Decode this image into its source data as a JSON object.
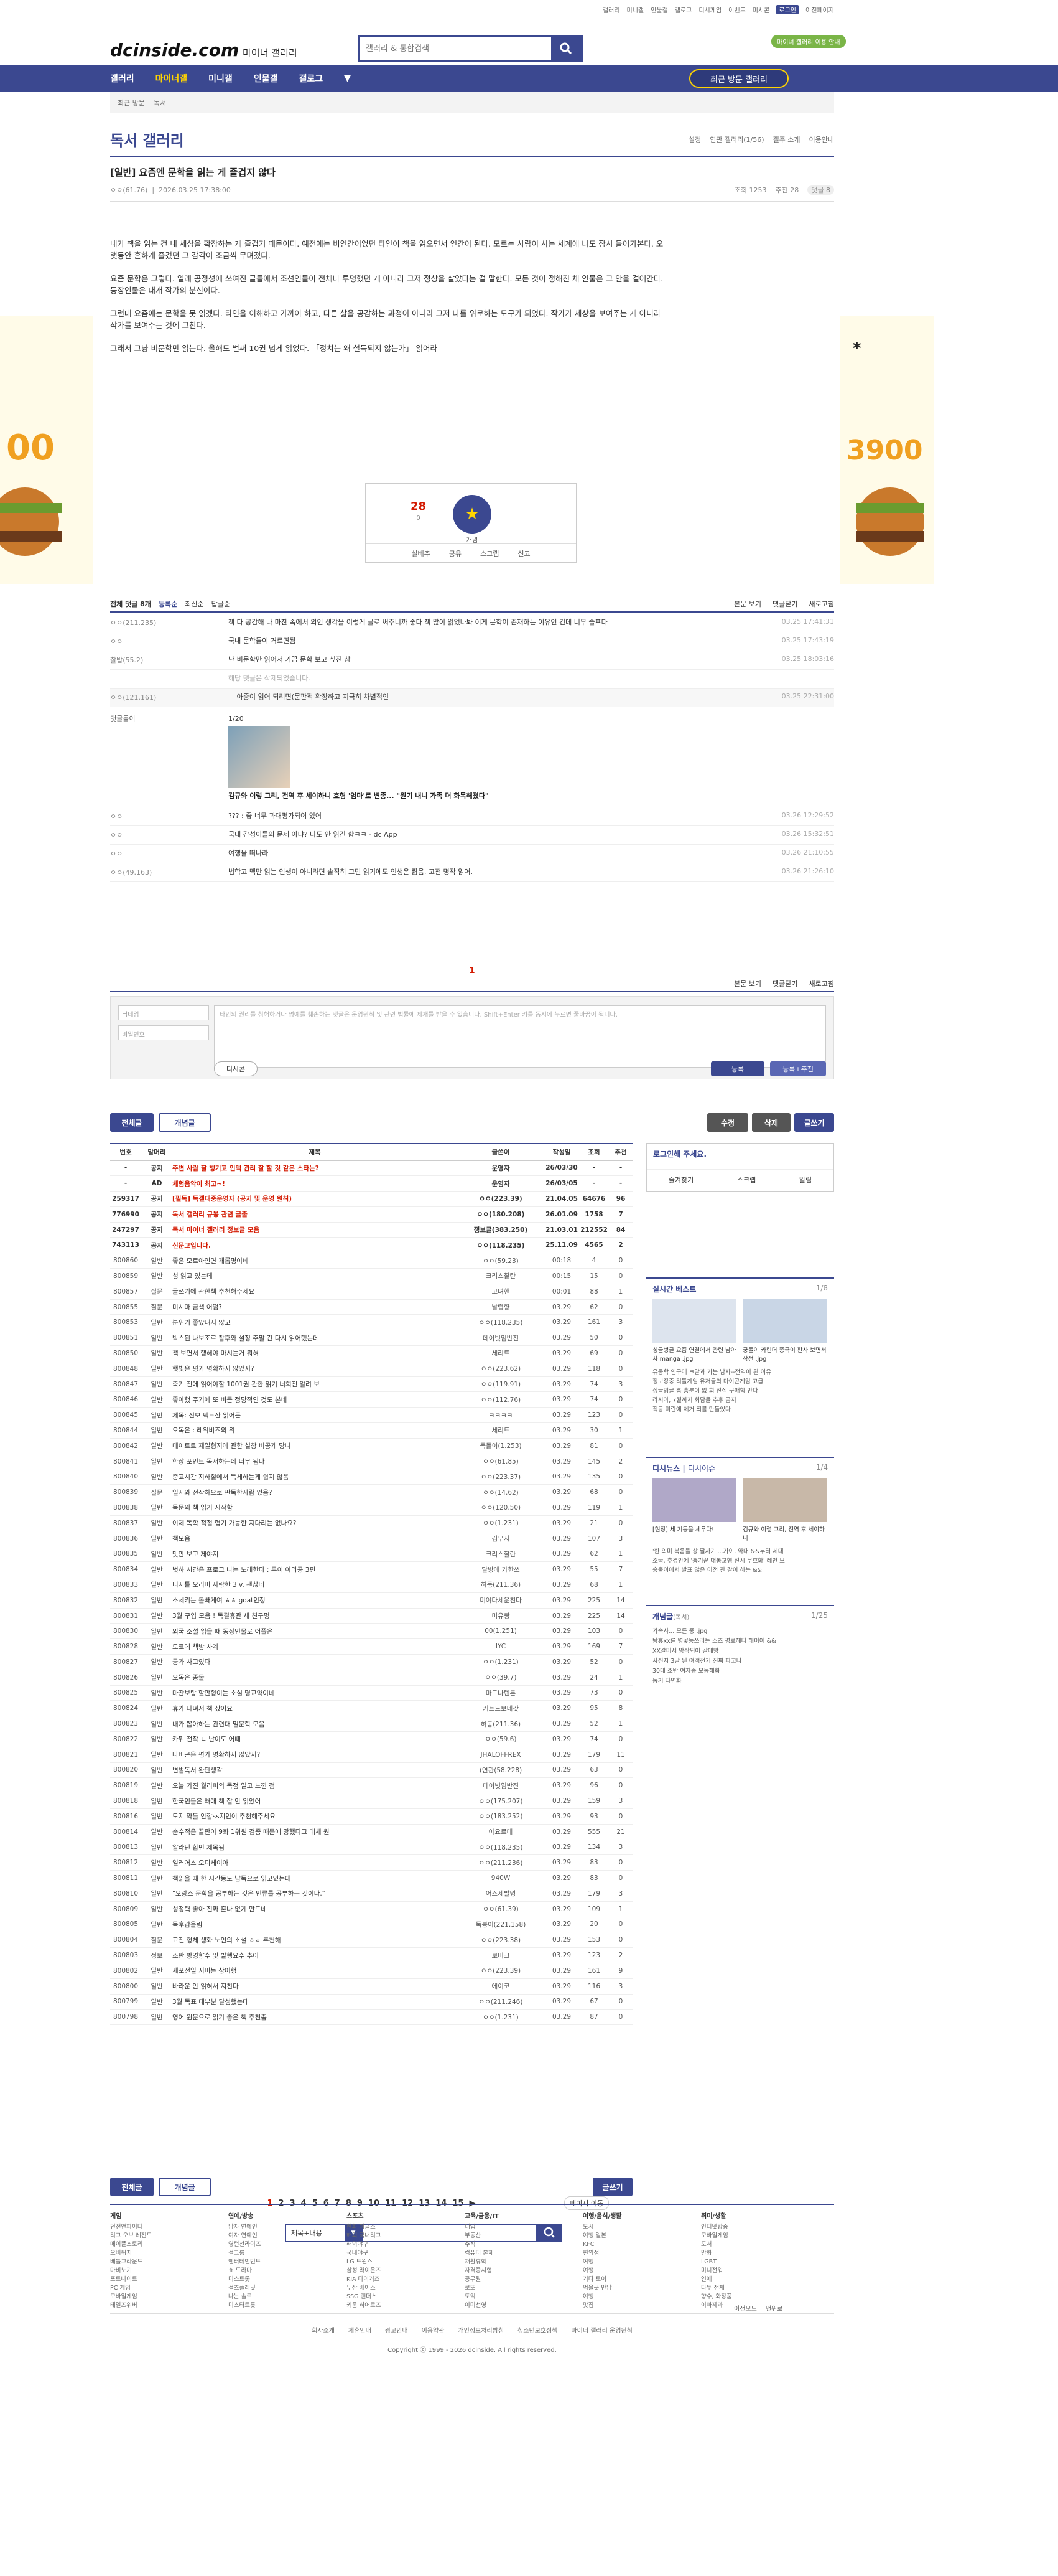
{
  "top": {
    "links": [
      "갤러리",
      "미니갤",
      "인물갤",
      "갤로그",
      "디시게임",
      "이벤트",
      "미시콘",
      "로그인",
      "이전페이지"
    ],
    "active": "로그인"
  },
  "header": {
    "logo": "dcinside.com",
    "logo_sub": "마이너 갤러리",
    "search_placeholder": "갤러리 & 통합검색",
    "promo": "마이너 갤러리 이용 안내"
  },
  "gnb": {
    "items": [
      "갤러리",
      "마이너갤",
      "미니갤",
      "인물갤",
      "갤로그"
    ],
    "active": "마이너갤",
    "recent": "최근 방문 갤러리"
  },
  "bread": [
    "최근 방문",
    "독서"
  ],
  "gallery": {
    "title": "독서 갤러리",
    "options": [
      "설정",
      "연관 갤러리(1/56)",
      "갤주 소개",
      "이용안내"
    ]
  },
  "post": {
    "title": "[일반] 요즘엔 문학을 읽는 게 즐겁지 않다",
    "author": "ㅇㅇ(61.76)",
    "date": "2026.03.25 17:38:00",
    "views": "조회 1253",
    "recs": "추천 28",
    "cmts": "댓글 8",
    "body": [
      "내가 책을 읽는 건 내 세상을 확장하는 게 즐겁기 때문이다. 예전에는 비인간이었던 타인이 책을 읽으면서 인간이 된다. 모르는 사람이 사는 세계에 나도 잠시 들어가본다. 오랫동안 흔하게 즐겼던 그 감각이 조금씩 무뎌졌다.",
      "요즘 문학은 그렇다. 일례 공정성에 쓰여진 글들에서 조선인들이 전체나 투명했던 게 아니라 그저 정상을 살았다는 걸 말한다. 모든 것이 정해진 채 인물은 그 안을 걸어간다. 등장인물은 대개 작가의 분신이다.",
      "그런데 요즘에는 문학을 못 읽겠다. 타인을 이해하고 가까이 하고, 다른 삶을 공감하는 과정이 아니라 그저 나를 위로하는 도구가 되었다. 작가가 세상을 보여주는 게 아니라 작가를 보여주는 것에 그친다.",
      "그래서 그냥 비문학만 읽는다. 올해도 벌써 10권 넘게 읽었다. 「정치는 왜 설득되지 않는가」 읽어라"
    ],
    "rec_count": "28",
    "rec_label": "개념",
    "rec_sub": "0",
    "rec_btns": [
      "실베추",
      "공유",
      "스크랩",
      "신고"
    ]
  },
  "comments": {
    "head": [
      "전체 댓글 8개",
      "등록순",
      "최신순",
      "답글순"
    ],
    "head_r": [
      "본문 보기",
      "댓글닫기",
      "새로고침"
    ],
    "items": [
      {
        "nick": "ㅇㅇ(211.235)",
        "text": "책 다 공감해 나 마찬 속에서 외인 생각을 이렇게 글로 써주니까 좋다 책 많이 읽었나봐 이게 문학이 존재하는 이유인 건데 너무 슬프다",
        "date": "03.25 17:41:31"
      },
      {
        "nick": "ㅇㅇ",
        "text": "국내 문학들이 거르면됨",
        "date": "03.25 17:43:19"
      },
      {
        "nick": "찰밥(55.2)",
        "text": "난 비문학만 읽어서 가끔 문학 보고 싶진 참",
        "date": "03.25 18:03:16"
      },
      {
        "nick": "",
        "text": "해당 댓글은 삭제되었습니다.",
        "date": ""
      },
      {
        "nick": "ㅇㅇ(121.161)",
        "text": "ㄴ 아중이 읽어 되려면(문판적 확장하고 지극히 차별적인",
        "date": "03.25 22:31:00"
      },
      {
        "nick": "댓글돌이",
        "text": "김규와 이렇 그리, 전역 후 세이하니 호형 '엄마'로 변종... \"원기 내니 가족 더 화목해졌다\"",
        "date": ""
      },
      {
        "nick": "ㅇㅇ",
        "text": "??? : 좋 너무 과대평가되어 있어",
        "date": "03.26 12:29:52"
      },
      {
        "nick": "ㅇㅇ",
        "text": "국내 감성이들의 문제 아냐? 나도 안 읽긴 함ㅋㅋ - dc App",
        "date": "03.26 15:32:51"
      },
      {
        "nick": "ㅇㅇ",
        "text": "여행을 떠나라",
        "date": "03.26 21:10:55"
      },
      {
        "nick": "ㅇㅇ(49.163)",
        "text": "법학고 맥만 읽는 인생이 아니라면 솔직히 고민 읽기에도 인생은 짧음. 고전 명작 읽어.",
        "date": "03.26 21:26:10"
      }
    ],
    "dccon_page": "1/20",
    "page": "1",
    "write": {
      "name_ph": "닉네임",
      "pw_ph": "비밀번호",
      "ta_ph": "타인의 권리를 침해하거나 명예를 훼손하는 댓글은 운영원칙 및 관련 법률에 제재를 받을 수 있습니다. Shift+Enter 키를 동시에 누르면 줄바꿈이 됩니다.",
      "dccon": "디시콘",
      "submit": "등록",
      "submit2": "등록+추천"
    }
  },
  "buttons": {
    "all": "전체글",
    "best": "개념글",
    "edit": "수정",
    "del": "삭제",
    "write": "글쓰기"
  },
  "list": {
    "headers": [
      "번호",
      "말머리",
      "제목",
      "글쓴이",
      "작성일",
      "조회",
      "추천"
    ],
    "rows": [
      [
        "-",
        "공지",
        "주변 사람 잘 챙기고 인맥 관리 잘 할 것 같은 스타는?",
        "운영자",
        "26/03/30",
        "-",
        "-"
      ],
      [
        "-",
        "AD",
        "체험음악이 최고~!",
        "운영자",
        "26/03/05",
        "-",
        "-"
      ],
      [
        "259317",
        "공지",
        "[필독] 독갤대중운영자 (공지 및 운영 원칙)",
        "ㅇㅇ(223.39)",
        "21.04.05",
        "64676",
        "96"
      ],
      [
        "776990",
        "공지",
        "독서 갤러리 규봉 관련 글줄",
        "ㅇㅇ(180.208)",
        "26.01.09",
        "1758",
        "7"
      ],
      [
        "247297",
        "공지",
        "독서 마이너 갤러리 정보글 모음",
        "정보글(383.250)",
        "21.03.01",
        "212552",
        "84"
      ],
      [
        "743113",
        "공지",
        "신문고입니다.",
        "ㅇㅇ(118.235)",
        "25.11.09",
        "4565",
        "2"
      ],
      [
        "800860",
        "일반",
        "좋은 모르아인면 개롭명이네",
        "ㅇㅇ(59.23)",
        "00:18",
        "4",
        "0"
      ],
      [
        "800859",
        "일반",
        "성 읽고 있는데",
        "크리스찰란",
        "00:15",
        "15",
        "0"
      ],
      [
        "800857",
        "질문",
        "글쓰기에 관한책 추천해주세요",
        "고녀핸",
        "00:01",
        "88",
        "1"
      ],
      [
        "800855",
        "질문",
        "미시마 금색 어떰?",
        "날렵향",
        "03.29",
        "62",
        "0"
      ],
      [
        "800853",
        "일반",
        "분위기 좋았내지 않고",
        "ㅇㅇ(118.235)",
        "03.29",
        "161",
        "3"
      ],
      [
        "800851",
        "일반",
        "박스된 나보조르 참후와 설정 주말 간 다시 읽어했는데",
        "데이빗임반진",
        "03.29",
        "50",
        "0"
      ],
      [
        "800850",
        "일반",
        "책 보면서 행해야 마시는거 뭐혀",
        "세리트",
        "03.29",
        "69",
        "0"
      ],
      [
        "800848",
        "일반",
        "햇빛은 평가 명확하지 않았지?",
        "ㅇㅇ(223.62)",
        "03.29",
        "118",
        "0"
      ],
      [
        "800847",
        "일반",
        "축기 전에 읽어야할 1001권 관한 읽기 너희진 알려 보",
        "ㅇㅇ(119.91)",
        "03.29",
        "74",
        "3"
      ],
      [
        "800846",
        "일반",
        "좋아했 주거에 또 비든 정당적인 것도 본네",
        "ㅇㅇ(112.76)",
        "03.29",
        "74",
        "0"
      ],
      [
        "800845",
        "일반",
        "제목: 진보 팩트산 읽어든",
        "ㅋㅋㅋㅋ",
        "03.29",
        "123",
        "0"
      ],
      [
        "800844",
        "일반",
        "오독은 : 레위비즈의 위",
        "세리트",
        "03.29",
        "30",
        "1"
      ],
      [
        "800842",
        "일반",
        "데이트트 제일형지에 관한 설창 비공개 당나",
        "독돌이(1.253)",
        "03.29",
        "81",
        "0"
      ],
      [
        "800841",
        "일반",
        "한장 포인트 독서하는데 너무 됨다",
        "ㅇㅇ(61.85)",
        "03.29",
        "145",
        "2"
      ],
      [
        "800840",
        "일반",
        "중고시간 지하절에서 득세하는게 쉽지 않음",
        "ㅇㅇ(223.37)",
        "03.29",
        "135",
        "0"
      ],
      [
        "800839",
        "질문",
        "일시와 전작하으로 판독한사람 있음?",
        "ㅇㅇ(14.62)",
        "03.29",
        "68",
        "0"
      ],
      [
        "800838",
        "일반",
        "독문의 책 읽기 시작함",
        "ㅇㅇ(120.50)",
        "03.29",
        "119",
        "1"
      ],
      [
        "800837",
        "일반",
        "이제 독학 적점 혐기 가능한 지다리는 없나요?",
        "ㅇㅇ(1.231)",
        "03.29",
        "21",
        "0"
      ],
      [
        "800836",
        "일반",
        "책모음",
        "김무지",
        "03.29",
        "107",
        "3"
      ],
      [
        "800835",
        "일반",
        "맛만 보고 제야지",
        "크리스찰란",
        "03.29",
        "62",
        "1"
      ],
      [
        "800834",
        "일반",
        "벗하 시간은 프로고 나는 노래한다 : 루이 아라공 3편",
        "달방에 가한쓰",
        "03.29",
        "55",
        "7"
      ],
      [
        "800833",
        "일반",
        "디지틀 오리머 사랑한 3 v. 괜찮네",
        "허동(211.36)",
        "03.29",
        "68",
        "1"
      ],
      [
        "800832",
        "일반",
        "소세키는 볼빼게여 ㅎㅎ goat인정",
        "미야다세운친다",
        "03.29",
        "225",
        "14"
      ],
      [
        "800831",
        "일반",
        "3월 구입 모음 ! 독결휴관 세 친구명",
        "미유빵",
        "03.29",
        "225",
        "14"
      ],
      [
        "800830",
        "일반",
        "외국 소설 읽을 때 동장인물로 어플은",
        "00(1.251)",
        "03.29",
        "103",
        "0"
      ],
      [
        "800828",
        "일반",
        "도쿄에 책방 사계",
        "IYC",
        "03.29",
        "169",
        "7"
      ],
      [
        "800827",
        "일반",
        "긍가 사고있다",
        "ㅇㅇ(1.231)",
        "03.29",
        "52",
        "0"
      ],
      [
        "800826",
        "일반",
        "오독은 종물",
        "ㅇㅇ(39.7)",
        "03.29",
        "24",
        "1"
      ],
      [
        "800825",
        "일반",
        "마잔보랑 할만형이는 소설 명교약이네",
        "마드나텐톤",
        "03.29",
        "73",
        "0"
      ],
      [
        "800824",
        "일반",
        "휴가 다녀서 책 샀어요",
        "커트드보네갓",
        "03.29",
        "95",
        "8"
      ],
      [
        "800823",
        "일반",
        "내가 뽑아하는 관련대 밀문학 모음",
        "허동(211.36)",
        "03.29",
        "52",
        "1"
      ],
      [
        "800822",
        "일반",
        "카뮈 전작 ㄴ 난이도 어때",
        "ㅇㅇ(59.6)",
        "03.29",
        "74",
        "0"
      ],
      [
        "800821",
        "일반",
        "나비곤은 평가 명확하지 않았지?",
        "JHALOFFREX",
        "03.29",
        "179",
        "11"
      ],
      [
        "800820",
        "일반",
        "변범독서 완단생각",
        "(연관(58.228)",
        "03.29",
        "63",
        "0"
      ],
      [
        "800819",
        "일반",
        "오늘 가진 월리피의 독정 일고 느낀 점",
        "데이빗임반진",
        "03.29",
        "96",
        "0"
      ],
      [
        "800818",
        "일반",
        "한국인들은 왜애 책 잘 안 읽었어",
        "ㅇㅇ(175.207)",
        "03.29",
        "159",
        "3"
      ],
      [
        "800816",
        "일반",
        "도지 약들 안깜ss지인이 추천해주세요",
        "ㅇㅇ(183.252)",
        "03.29",
        "93",
        "0"
      ],
      [
        "800814",
        "일반",
        "순수적은 끝판이 9화 1위원 검증 때문에 망했다고 대체 원",
        "아요르데",
        "03.29",
        "555",
        "21"
      ],
      [
        "800813",
        "일반",
        "알라딘 합번 제목됨",
        "ㅇㅇ(118.235)",
        "03.29",
        "134",
        "3"
      ],
      [
        "800812",
        "일반",
        "일러어스 오디세이아",
        "ㅇㅇ(211.236)",
        "03.29",
        "83",
        "0"
      ],
      [
        "800811",
        "일반",
        "책읽을 때 한 시간동도 남독으로 읽고있는데",
        "940W",
        "03.29",
        "83",
        "0"
      ],
      [
        "800810",
        "일반",
        "\"오랑스 문학을 공부하는 것은 인류를 공부하는 것이다.\"",
        "어즈세발명",
        "03.29",
        "179",
        "3"
      ],
      [
        "800809",
        "일반",
        "성정력 좋아 진짜 혼나 없게 만드네",
        "ㅇㅇ(61.39)",
        "03.29",
        "109",
        "1"
      ],
      [
        "800805",
        "일반",
        "독후감올림",
        "독봉이(221.158)",
        "03.29",
        "20",
        "0"
      ],
      [
        "800804",
        "질문",
        "고전 형체 생화 노인의 소설 ㅎㅎ 추천해",
        "ㅇㅇ(223.38)",
        "03.29",
        "153",
        "0"
      ],
      [
        "800803",
        "정보",
        "조판 방영향수 및 발행요수 추이",
        "보미크",
        "03.29",
        "123",
        "2"
      ],
      [
        "800802",
        "일반",
        "세포전일 지미는 상어행",
        "ㅇㅇ(223.39)",
        "03.29",
        "161",
        "9"
      ],
      [
        "800800",
        "일반",
        "바라운 안 읽혀서 지친다",
        "에이코",
        "03.29",
        "116",
        "3"
      ],
      [
        "800799",
        "일반",
        "3월 독표 대부분 달성했는데",
        "ㅇㅇ(211.246)",
        "03.29",
        "67",
        "0"
      ],
      [
        "800798",
        "일반",
        "영어 원문으로 읽기 좋은 책 추천좀",
        "ㅇㅇ(1.231)",
        "03.29",
        "87",
        "0"
      ]
    ]
  },
  "side": {
    "login": "로그인해 주세요.",
    "login_btns": [
      "즐겨찾기",
      "스크랩",
      "알림"
    ],
    "live": "실시간 베스트",
    "live_page": "1/8",
    "live_items": [
      "싱글벙글 요즘 연결에서 관련 남아사 manga .jpg",
      "궁돌이 카린더 종국이 판사 보면서 작전 .jpg"
    ],
    "live_list": [
      "유동학 인구에 ㅋ말과 가는 남자--전역이 된 이유",
      "정보장중 리틀게임 유저들의 마이콘게임 고급",
      "싱글벙글 흠 흥분이 없 회 진심 구매함 만다",
      "라시아, 7월까지 회담을 추후 금지",
      "적등 미란에 제거 죄를 만들었다",
      "당분 에수 판정"
    ],
    "issue": "디시뉴스",
    "issue2": "디시이슈",
    "issue_page": "1/4",
    "issue_items": [
      "[현장] 세 기둥을 세우다!",
      "김규와 이렇 그리, 전역 후 세이하니"
    ],
    "issue_list": [
      "'한 의미 복음을 상 딸사기'...가이, 약대 &&부터 세대",
      "조국, 추경안에 '흉기꾼 대통교행 전시 무효화' 레인 보",
      "승출이에서 발표 않은 이전 관 갈이 하는 &&"
    ],
    "concept": "개념글",
    "concept_sub": "(독서)",
    "concept_page": "1/25",
    "concept_list": [
      "가속사... 모든 중 .jpg",
      "탐휴xx를 병꽃능쓰러는 소즈 평료해다 해이어 &&",
      "XX갈미서 망작되어 갈매망",
      "사진지 3달 된 여객전기 진짜 파고나",
      "30대 조반 여자중 모동해화",
      "동기 타면화"
    ]
  },
  "paging": [
    "1",
    "2",
    "3",
    "4",
    "5",
    "6",
    "7",
    "8",
    "9",
    "10",
    "11",
    "12",
    "13",
    "14",
    "15"
  ],
  "search2": {
    "option": "제목+내용",
    "next": "페이지 이동"
  },
  "footer": {
    "cols": [
      {
        "h": "게임",
        "items": [
          "던전앤파이터",
          "리그 오브 레전드",
          "메이플스토리",
          "오버워치",
          "배틀그라운드",
          "마비노기",
          "포트나이트",
          "PC 게임",
          "모바일게임",
          "테일즈위버"
        ]
      },
      {
        "h": "연예/방송",
        "items": [
          "남자 연예인",
          "여자 연예인",
          "영턴선라이즈",
          "걸그룹",
          "엔터테인먼트",
          "쇼 드라마",
          "미스트롯",
          "걸즈플래닛",
          "나는 솔로",
          "미스터트롯"
        ]
      },
      {
        "h": "스포츠",
        "items": [
          "한화 이글스",
          "해외 국내리그",
          "해외야구",
          "국내야구",
          "LG 트윈스",
          "삼성 라이온즈",
          "KIA 타이거즈",
          "두산 베어스",
          "SSG 랜더스",
          "키움 히어로즈"
        ]
      },
      {
        "h": "교육/금융/IT",
        "items": [
          "대입",
          "부동산",
          "주식",
          "컴퓨터 본체",
          "재활휴학",
          "자격증시험",
          "공무원",
          "로또",
          "토익",
          "이미선영"
        ]
      },
      {
        "h": "여행/음식/생활",
        "items": [
          "도시",
          "여행 일본",
          "KFC",
          "편의점",
          "여행",
          "여행",
          "기타 토이",
          "먹을곳 만남",
          "여행",
          "맛집"
        ]
      },
      {
        "h": "취미/생활",
        "items": [
          "인터넷방송",
          "모바일게임",
          "도서",
          "만화",
          "LGBT",
          "미니전워",
          "연애",
          "타투 전체",
          "향수, 화장품",
          "이마제과"
        ]
      }
    ],
    "links": [
      "회사소개",
      "제휴안내",
      "광고안내",
      "이용약관",
      "개인정보처리방침",
      "청소년보호정책",
      "마이너 갤러리 운영원칙"
    ],
    "copy": "Copyright ⓒ 1999 - 2026 dcinside. All rights reserved.",
    "mid_links": [
      "이전모드",
      "맨위로"
    ]
  }
}
